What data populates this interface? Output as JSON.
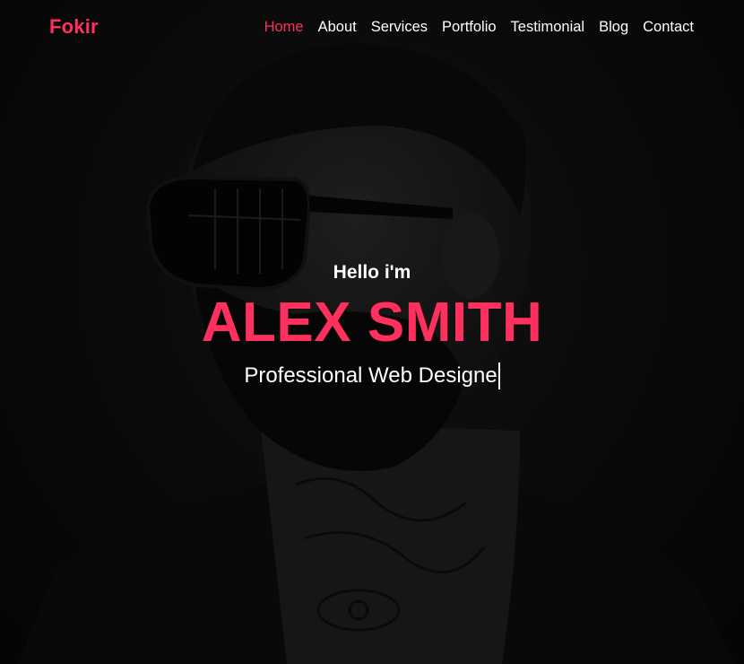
{
  "brand": {
    "logo_text": "Fokir",
    "accent_color": "#ff2f5e"
  },
  "nav": {
    "items": [
      {
        "label": "Home",
        "active": true
      },
      {
        "label": "About",
        "active": false
      },
      {
        "label": "Services",
        "active": false
      },
      {
        "label": "Portfolio",
        "active": false
      },
      {
        "label": "Testimonial",
        "active": false
      },
      {
        "label": "Blog",
        "active": false
      },
      {
        "label": "Contact",
        "active": false
      }
    ]
  },
  "hero": {
    "greeting": "Hello i'm",
    "name": "ALEX SMITH",
    "typed_role": "Professional Web Designe",
    "background_image": "dark-portrait-bearded-man-sunglasses"
  }
}
